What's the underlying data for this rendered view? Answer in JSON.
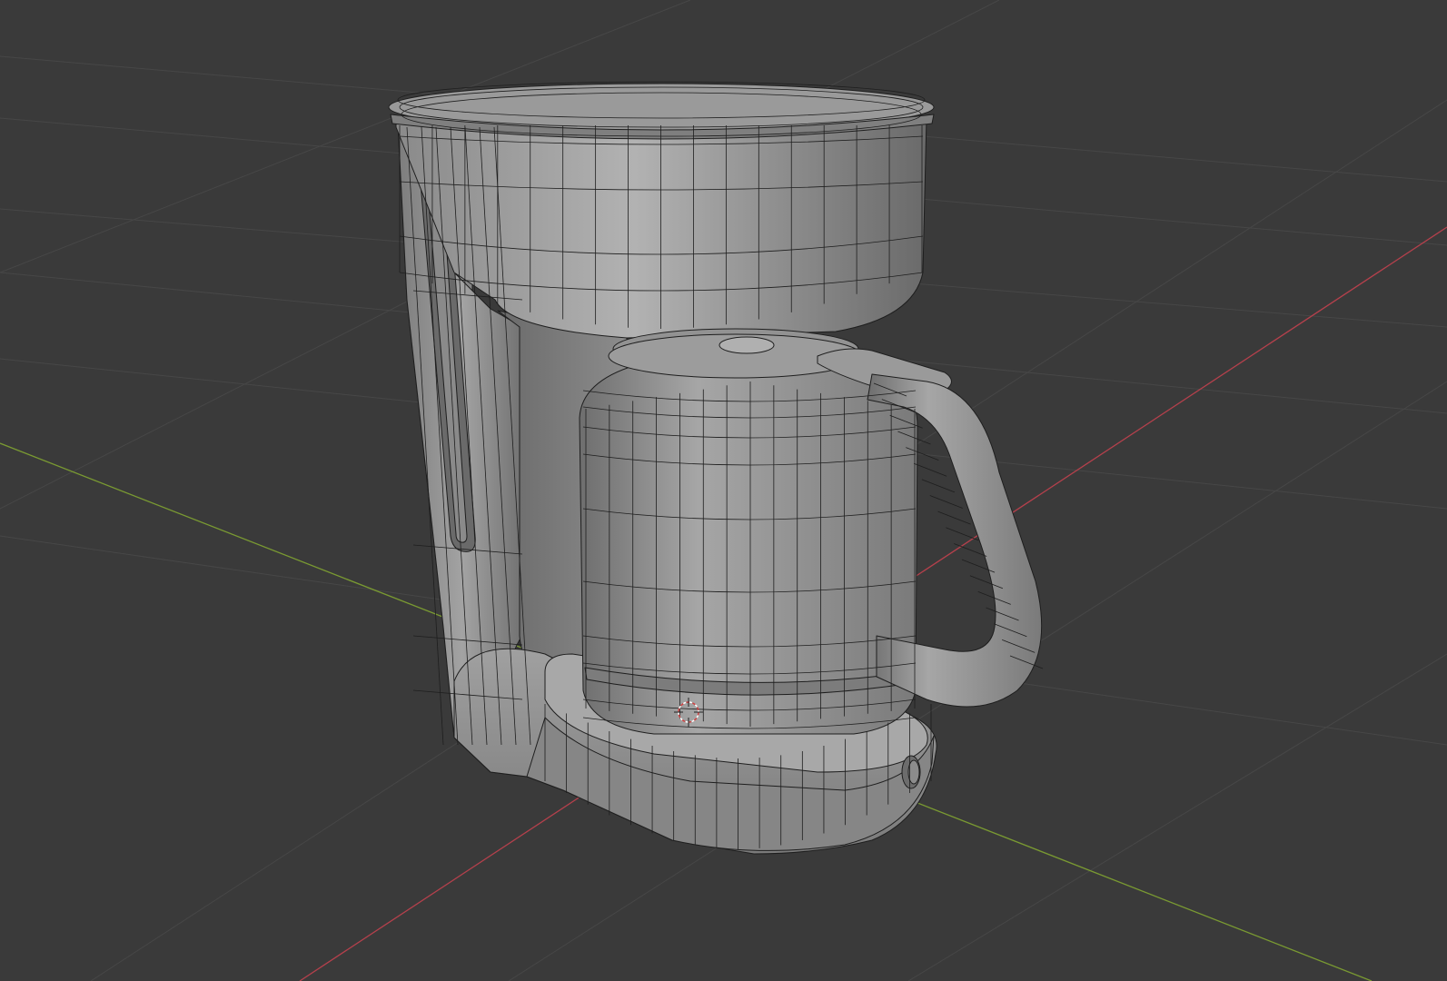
{
  "viewport": {
    "background_color": "#3a3a3a",
    "grid_color": "#474747",
    "x_axis_color": "#b5404c",
    "y_axis_color": "#7a9a32",
    "mesh_fill_color": "#909090",
    "wire_color": "#1e1e1e",
    "cursor_color": "#d04040"
  },
  "scene": {
    "object": "coffee-maker-mesh",
    "display_mode": "wireframe-overlay",
    "cursor": "3d-cursor"
  }
}
